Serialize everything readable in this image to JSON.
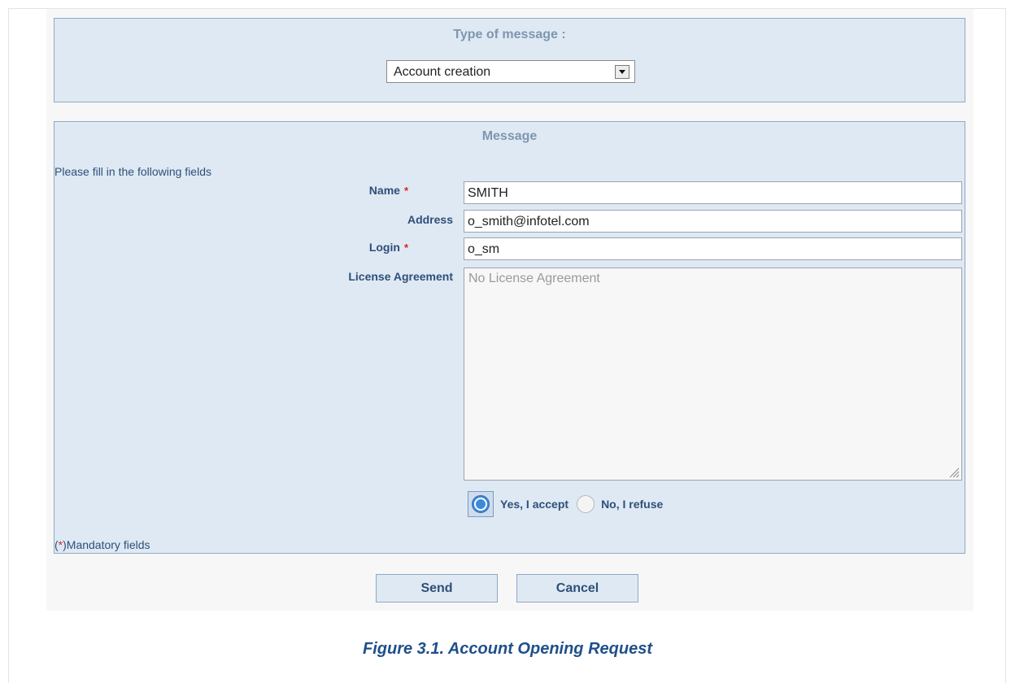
{
  "type_panel": {
    "title": "Type of message :",
    "selected_option": "Account creation"
  },
  "message_panel": {
    "title": "Message",
    "instructions": "Please fill in the following fields",
    "fields": {
      "name": {
        "label": "Name",
        "value": "SMITH",
        "required": true
      },
      "address": {
        "label": "Address",
        "value": "o_smith@infotel.com",
        "required": false
      },
      "login": {
        "label": "Login",
        "value": "o_sm",
        "required": true
      },
      "license": {
        "label": "License Agreement",
        "placeholder": "No License Agreement"
      }
    },
    "agreement": {
      "accept_label": "Yes, I accept",
      "refuse_label": "No, I refuse",
      "selected": "accept"
    },
    "required_marker": "*",
    "mandatory_note": {
      "open": "(",
      "star": "*",
      "close": ")Mandatory fields"
    }
  },
  "buttons": {
    "send": "Send",
    "cancel": "Cancel"
  },
  "caption": "Figure 3.1. Account Opening Request",
  "colors": {
    "panel_bg": "#dfe9f3",
    "panel_border": "#8ea9c4",
    "label_text": "#2e4f7a",
    "title_text": "#7f96b0",
    "required": "#e02020",
    "caption": "#1f4f8a",
    "radio_selected": "#3d8ad8"
  }
}
